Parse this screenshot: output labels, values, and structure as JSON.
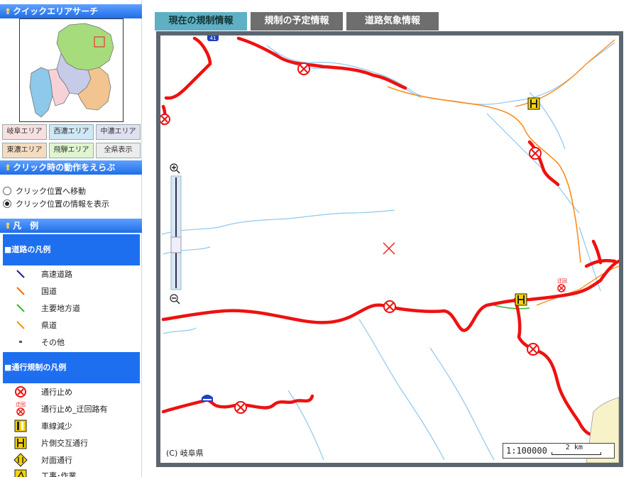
{
  "left": {
    "quick_area_title": "クイックエリアサーチ",
    "area_buttons": [
      {
        "label": "岐阜エリア",
        "bg": "#f8e0e0"
      },
      {
        "label": "西濃エリア",
        "bg": "#cfe8f5"
      },
      {
        "label": "中濃エリア",
        "bg": "#dfe0f0"
      },
      {
        "label": "東濃エリア",
        "bg": "#f5dcc0"
      },
      {
        "label": "飛騨エリア",
        "bg": "#dff5cf"
      },
      {
        "label": "全県表示",
        "bg": "#ececec"
      }
    ],
    "click_action_title": "クリック時の動作をえらぶ",
    "click_options": [
      {
        "label": "クリック位置へ移動",
        "checked": false
      },
      {
        "label": "クリック位置の情報を表示",
        "checked": true
      }
    ],
    "legend_title": "凡　例",
    "road_legend_title": "■道路の凡例",
    "road_legend": [
      {
        "label": "高速道路",
        "color": "#202080"
      },
      {
        "label": "国道",
        "color": "#ff6a00"
      },
      {
        "label": "主要地方道",
        "color": "#33bb33"
      },
      {
        "label": "県道",
        "color": "#e8a000"
      },
      {
        "label": "その他",
        "color": "#555555"
      }
    ],
    "reg_legend_title": "■通行規制の凡例",
    "reg_legend": [
      {
        "label": "通行止め",
        "icon": "closure-icon"
      },
      {
        "label": "通行止め_迂回路有",
        "icon": "closure-detour-icon"
      },
      {
        "label": "車線減少",
        "icon": "lane-reduction-icon"
      },
      {
        "label": "片側交互通行",
        "icon": "alternating-traffic-icon"
      },
      {
        "label": "対面通行",
        "icon": "two-way-icon"
      },
      {
        "label": "工事･作業",
        "icon": "construction-icon"
      }
    ],
    "detour_icon_text": "迂回"
  },
  "tabs": [
    {
      "label": "現在の規制情報",
      "active": true
    },
    {
      "label": "規制の予定情報",
      "active": false
    },
    {
      "label": "道路気象情報",
      "active": false
    }
  ],
  "map": {
    "copyright": "(C) 岐阜県",
    "scale": "1:100000",
    "scale_unit": "2 km",
    "route_badge": "41",
    "detour_label": "迂回"
  },
  "colors": {
    "regulation_red": "#ee1111",
    "national_road": "#ff8c1a",
    "river": "#8fc8ee"
  }
}
